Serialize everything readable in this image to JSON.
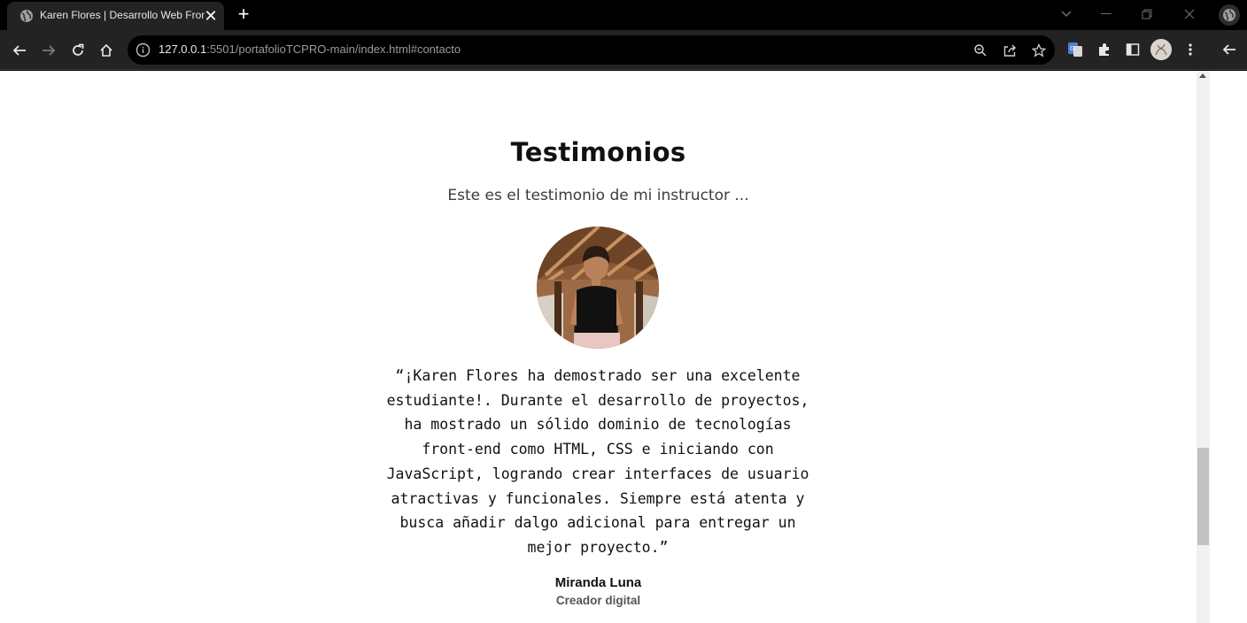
{
  "browser": {
    "tab": {
      "title": "Karen Flores | Desarrollo Web Front-End",
      "close_glyph": "✕"
    },
    "new_tab_glyph": "+",
    "address": {
      "host": "127.0.0.1",
      "rest": ":5501/portafolioTCPRO-main/index.html#contacto"
    }
  },
  "page": {
    "section_title": "Testimonios",
    "subtitle": "Este es el testimonio de mi instructor ...",
    "quote": "“¡Karen Flores ha demostrado ser una excelente estudiante!. Durante el desarrollo de proyectos, ha mostrado un sólido dominio de tecnologías front-end como HTML, CSS e iniciando con JavaScript, logrando crear interfaces de usuario atractivas y funcionales. Siempre está atenta y busca añadir dalgo adicional para entregar un mejor proyecto.”",
    "author_name": "Miranda Luna",
    "author_role": "Creador digital"
  },
  "scroll": {
    "position_fraction": 0.84
  },
  "colors": {
    "page_bg": "#ffffff",
    "chrome_bg": "#232323",
    "tabbar_bg": "#000000"
  }
}
